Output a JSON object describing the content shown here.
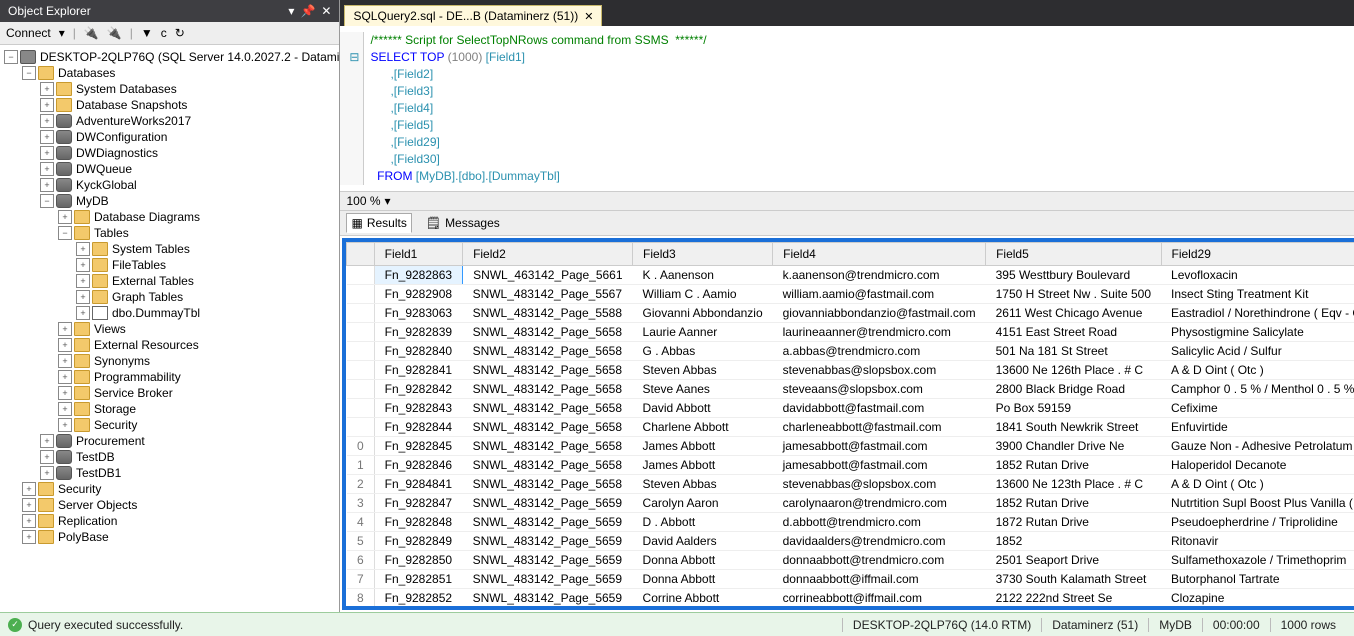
{
  "explorer": {
    "title": "Object Explorer",
    "connect_label": "Connect",
    "server": "DESKTOP-2QLP76Q (SQL Server 14.0.2027.2 - Datami",
    "nodes": {
      "databases": "Databases",
      "system_databases": "System Databases",
      "database_snapshots": "Database Snapshots",
      "adventureworks": "AdventureWorks2017",
      "dwconfig": "DWConfiguration",
      "dwdiag": "DWDiagnostics",
      "dwqueue": "DWQueue",
      "kyckglobal": "KyckGlobal",
      "mydb": "MyDB",
      "db_diagrams": "Database Diagrams",
      "tables": "Tables",
      "system_tables": "System Tables",
      "filetables": "FileTables",
      "external_tables": "External Tables",
      "graph_tables": "Graph Tables",
      "dummaytbl": "dbo.DummayTbl",
      "views": "Views",
      "ext_resources": "External Resources",
      "synonyms": "Synonyms",
      "programmability": "Programmability",
      "service_broker": "Service Broker",
      "storage": "Storage",
      "security_db": "Security",
      "procurement": "Procurement",
      "testdb": "TestDB",
      "testdb1": "TestDB1",
      "security": "Security",
      "server_objects": "Server Objects",
      "replication": "Replication",
      "polybase": "PolyBase"
    }
  },
  "tab": {
    "label": "SQLQuery2.sql - DE...B (Dataminerz (51))"
  },
  "sql": {
    "l1": "/****** Script for SelectTopNRows command from SSMS  ******/",
    "l2a": "SELECT",
    "l2b": " TOP",
    "l2c": " (1000) ",
    "l2d": "[Field1]",
    "l3": "      ,[Field2]",
    "l4": "      ,[Field3]",
    "l5": "      ,[Field4]",
    "l6": "      ,[Field5]",
    "l7": "      ,[Field29]",
    "l8": "      ,[Field30]",
    "l9a": "  FROM",
    "l9b": " [MyDB].[dbo].[DummayTbl]"
  },
  "zoom": "100 %",
  "results_tabs": {
    "results": "Results",
    "messages": "Messages"
  },
  "grid": {
    "headers": [
      "",
      "Field1",
      "Field2",
      "Field3",
      "Field4",
      "Field5",
      "Field29"
    ],
    "rows": [
      [
        "",
        "Fn_9282863",
        "SNWL_463142_Page_5661",
        "K . Aanenson",
        "k.aanenson@trendmicro.com",
        "395 Westtbury Boulevard",
        "Levofloxacin"
      ],
      [
        "",
        "Fn_9282908",
        "SNWL_483142_Page_5567",
        "William C . Aamio",
        "william.aamio@fastmail.com",
        "1750 H Street Nw . Suite 500",
        "Insect Sting Treatment Kit"
      ],
      [
        "",
        "Fn_9283063",
        "SNWL_483142_Page_5588",
        "Giovanni Abbondanzio",
        "giovanniabbondanzio@fastmail.com",
        "2611 West Chicago Avenue",
        "Eastradiol / Norethindrone ( Eqv - Com Bipatch"
      ],
      [
        "",
        "Fn_9282839",
        "SNWL_483142_Page_5658",
        "Laurie Aanner",
        "laurineaanner@trendmicro.com",
        "4151 East Street Road",
        "Physostigmine Salicylate"
      ],
      [
        "",
        "Fn_9282840",
        "SNWL_483142_Page_5658",
        "G . Abbas",
        "a.abbas@trendmicro.com",
        "501 Na 181 St Street",
        "Salicylic Acid / Sulfur"
      ],
      [
        "",
        "Fn_9282841",
        "SNWL_483142_Page_5658",
        "Steven Abbas",
        "stevenabbas@slopsbox.com",
        "13600 Ne 126th  Place . # C",
        "A & D Oint ( Otc )"
      ],
      [
        "",
        "Fn_9282842",
        "SNWL_483142_Page_5658",
        "Steve Aanes",
        "steveaans@slopsbox.com",
        "2800 Black Bridge Road",
        "Camphor 0 . 5 % / Menthol 0 . 5 %"
      ],
      [
        "",
        "Fn_9282843",
        "SNWL_483142_Page_5658",
        "David Abbott",
        "davidabbott@fastmail.com",
        "Po Box 59159",
        "Cefixime"
      ],
      [
        "",
        "Fn_9282844",
        "SNWL_483142_Page_5658",
        "Charlene Abbott",
        "charleneabbott@fastmail.com",
        "1841 South Newkrik Street",
        "Enfuvirtide"
      ],
      [
        "0",
        "Fn_9282845",
        "SNWL_483142_Page_5658",
        "James Abbott",
        "jamesabbott@fastmail.com",
        "3900 Chandler Drive Ne",
        "Gauze Non - Adhesive Petrolatum"
      ],
      [
        "1",
        "Fn_9282846",
        "SNWL_483142_Page_5658",
        "James Abbott",
        "jamesabbott@fastmail.com",
        "1852 Rutan Drive",
        "Haloperidol Decanote"
      ],
      [
        "2",
        "Fn_9284841",
        "SNWL_483142_Page_5658",
        "Steven Abbas",
        "stevenabbas@slopsbox.com",
        "13600 Ne 123th Place . # C",
        "A & D Oint ( Otc )"
      ],
      [
        "3",
        "Fn_9282847",
        "SNWL_483142_Page_5659",
        "Carolyn Aaron",
        "carolynaaron@trendmicro.com",
        "1852 Rutan Drive",
        "Nutrtition Supl Boost Plus Vanilla ( Otc )"
      ],
      [
        "4",
        "Fn_9282848",
        "SNWL_483142_Page_5659",
        "D . Abbott",
        "d.abbott@trendmicro.com",
        "1872 Rutan Drive",
        "Pseudoepherdrine / Triprolidine"
      ],
      [
        "5",
        "Fn_9282849",
        "SNWL_483142_Page_5659",
        "David Aalders",
        "davidaalders@trendmicro.com",
        "1852",
        "Ritonavir"
      ],
      [
        "6",
        "Fn_9282850",
        "SNWL_483142_Page_5659",
        "Donna Abbott",
        "donnaabbott@trendmicro.com",
        "2501 Seaport Drive",
        "Sulfamethoxazole / Trimethoprim"
      ],
      [
        "7",
        "Fn_9282851",
        "SNWL_483142_Page_5659",
        "Donna Abbott",
        "donnaabbott@iffmail.com",
        "3730 South Kalamath Street",
        "Butorphanol Tartrate"
      ],
      [
        "8",
        "Fn_9282852",
        "SNWL_483142_Page_5659",
        "Corrine Abbott",
        "corrineabbott@iffmail.com",
        "2122 222nd Street Se",
        "Clozapine"
      ]
    ]
  },
  "status": {
    "msg": "Query executed successfully.",
    "server": "DESKTOP-2QLP76Q (14.0 RTM)",
    "user": "Dataminerz (51)",
    "db": "MyDB",
    "time": "00:00:00",
    "rows": "1000 rows"
  }
}
